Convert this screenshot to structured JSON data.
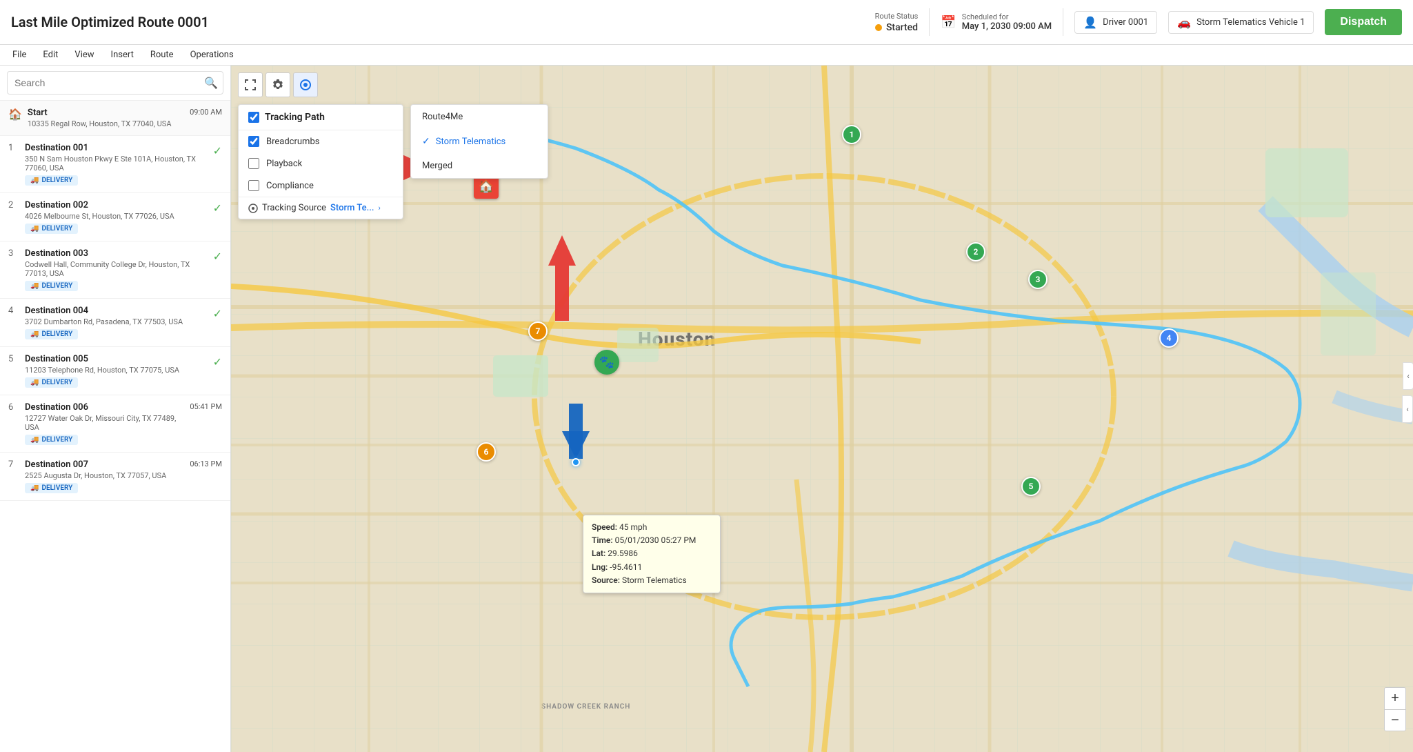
{
  "app": {
    "title": "Last Mile Optimized Route 0001"
  },
  "header": {
    "route_status_label": "Route Status",
    "route_status_value": "Started",
    "scheduled_label": "Scheduled for",
    "scheduled_value": "May 1, 2030 09:00 AM",
    "driver_label": "Driver 0001",
    "vehicle_label": "Storm Telematics Vehicle 1",
    "dispatch_label": "Dispatch"
  },
  "menubar": {
    "items": [
      "File",
      "Edit",
      "View",
      "Insert",
      "Route",
      "Operations"
    ]
  },
  "sidebar": {
    "search_placeholder": "Search",
    "stops": [
      {
        "number": "",
        "name": "Start",
        "address": "10335 Regal Row, Houston, TX 77040, USA",
        "time": "09:00 AM",
        "type": "start",
        "completed": false
      },
      {
        "number": "1",
        "name": "Destination 001",
        "address": "350 N Sam Houston Pkwy E Ste 101A, Houston, TX 77060, USA",
        "time": "",
        "type": "delivery",
        "completed": true
      },
      {
        "number": "2",
        "name": "Destination 002",
        "address": "4026 Melbourne St, Houston, TX 77026, USA",
        "time": "",
        "type": "delivery",
        "completed": true
      },
      {
        "number": "3",
        "name": "Destination 003",
        "address": "Codwell Hall, Community College Dr, Houston, TX 77013, USA",
        "time": "",
        "type": "delivery",
        "completed": true
      },
      {
        "number": "4",
        "name": "Destination 004",
        "address": "3702 Dumbarton Rd, Pasadena, TX 77503, USA",
        "time": "",
        "type": "delivery",
        "completed": true
      },
      {
        "number": "5",
        "name": "Destination 005",
        "address": "11203 Telephone Rd, Houston, TX 77075, USA",
        "time": "",
        "type": "delivery",
        "completed": true
      },
      {
        "number": "6",
        "name": "Destination 006",
        "address": "12727 Water Oak Dr, Missouri City, TX 77489, USA",
        "time": "05:41 PM",
        "type": "delivery",
        "completed": false
      },
      {
        "number": "7",
        "name": "Destination 007",
        "address": "2525 Augusta Dr, Houston, TX 77057, USA",
        "time": "06:13 PM",
        "type": "delivery",
        "completed": false
      }
    ]
  },
  "tracking_panel": {
    "title": "Tracking Path",
    "options": [
      {
        "label": "Breadcrumbs",
        "checked": true
      },
      {
        "label": "Playback",
        "checked": false
      },
      {
        "label": "Compliance",
        "checked": false
      }
    ],
    "source_label": "Tracking Source",
    "source_value": "Storm Te...",
    "source_menu": {
      "items": [
        "Route4Me",
        "Storm Telematics",
        "Merged"
      ],
      "selected": "Storm Telematics"
    }
  },
  "tooltip": {
    "speed": "45 mph",
    "time": "05/01/2030 05:27 PM",
    "lat": "29.5986",
    "lng": "-95.4611",
    "source": "Storm Telematics"
  },
  "map": {
    "city_label": "Houston",
    "bottom_label": "SHADOW CREEK RANCH"
  },
  "markers": [
    {
      "id": "1",
      "label": "1",
      "style": "green"
    },
    {
      "id": "2",
      "label": "2",
      "style": "green"
    },
    {
      "id": "3",
      "label": "3",
      "style": "green"
    },
    {
      "id": "4",
      "label": "4",
      "style": "default"
    },
    {
      "id": "5",
      "label": "5",
      "style": "green"
    },
    {
      "id": "6",
      "label": "6",
      "style": "orange"
    },
    {
      "id": "7",
      "label": "7",
      "style": "orange"
    }
  ],
  "icons": {
    "search": "🔍",
    "home": "🏠",
    "calendar": "📅",
    "driver": "👤",
    "vehicle": "🚗",
    "truck": "🚚",
    "gear": "⚙",
    "fullscreen": "⛶",
    "tracking": "◎",
    "paw": "🐾",
    "chevron_right": "›",
    "chevron_left": "‹",
    "check": "✓",
    "zoom_in": "+",
    "zoom_out": "−"
  },
  "colors": {
    "accent_blue": "#1a73e8",
    "green": "#34a853",
    "orange": "#ea8c00",
    "red": "#ea4335",
    "dispatch_green": "#4caf50"
  }
}
